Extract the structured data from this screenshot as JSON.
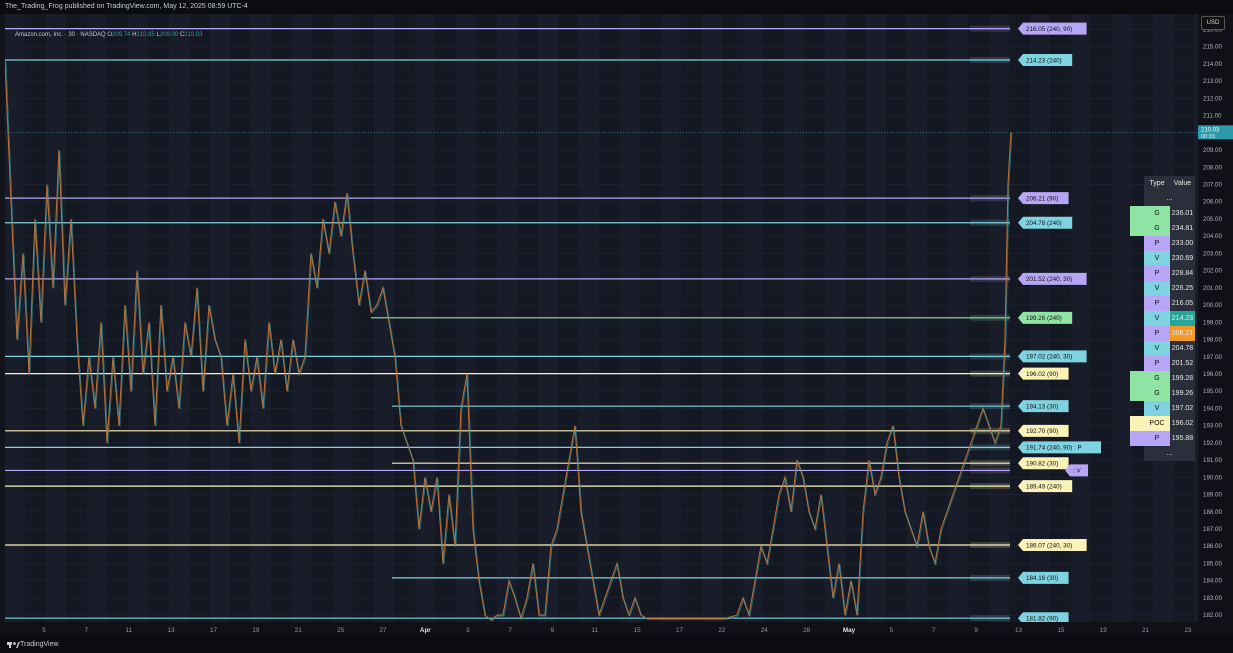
{
  "header": {
    "published": "The_Trading_Frog published on TradingView.com, May 12, 2025 08:59 UTC-4",
    "symbol": "Amazon.com, Inc. · 30 · NASDAQ",
    "ohlc": {
      "o_label": "O",
      "o": "209.74",
      "h_label": "H",
      "h": "210.85",
      "l_label": "L",
      "l": "209.00",
      "c_label": "C",
      "c": "210.03"
    }
  },
  "currency_button": "USD",
  "footer": {
    "brand": "TradingView"
  },
  "colors": {
    "green": "#8fe3a3",
    "purple": "#b7a6f5",
    "cyan": "#7fd3e0",
    "yellow": "#fbf2b8",
    "orange": "#f59a23"
  },
  "chart_data": {
    "type": "line",
    "title": "",
    "ylim": [
      181.6,
      216.9
    ],
    "price_ticks": [
      "216.00",
      "215.00",
      "214.00",
      "213.00",
      "212.00",
      "211.00",
      "210.00",
      "209.00",
      "208.00",
      "207.00",
      "206.00",
      "205.00",
      "204.00",
      "203.00",
      "202.00",
      "201.00",
      "200.00",
      "199.00",
      "198.00",
      "197.00",
      "196.00",
      "195.00",
      "194.00",
      "193.00",
      "192.00",
      "191.00",
      "190.00",
      "189.00",
      "188.00",
      "187.00",
      "186.00",
      "185.00",
      "184.00",
      "183.00",
      "182.00"
    ],
    "current_price": {
      "price": "210.03",
      "countdown": "00:33",
      "value": 210.03
    },
    "date_ticks": [
      "5",
      "7",
      "11",
      "13",
      "17",
      "19",
      "21",
      "25",
      "27",
      "Apr",
      "3",
      "7",
      "9",
      "11",
      "15",
      "17",
      "22",
      "24",
      "28",
      "May",
      "5",
      "7",
      "9",
      "13",
      "15",
      "19",
      "21",
      "23"
    ],
    "levels": [
      {
        "price": 216.05,
        "label": "216.05 (240, 90)",
        "color": "purple"
      },
      {
        "price": 214.23,
        "label": "214.23 (240)",
        "color": "cyan"
      },
      {
        "price": 206.21,
        "label": "206.21 (90)",
        "color": "purple"
      },
      {
        "price": 204.78,
        "label": "204.78 (240)",
        "color": "cyan"
      },
      {
        "price": 201.52,
        "label": "201.52 (240, 30)",
        "color": "purple"
      },
      {
        "price": 199.26,
        "label": "199.26 (240)",
        "color": "green"
      },
      {
        "price": 197.02,
        "label": "197.02 (240, 30)",
        "color": "cyan"
      },
      {
        "price": 196.02,
        "label": "196.02 (90)",
        "color": "yellow"
      },
      {
        "price": 194.13,
        "label": "194.13 (30)",
        "color": "cyan"
      },
      {
        "price": 192.7,
        "label": "192.70 (90)",
        "color": "yellow"
      },
      {
        "price": 191.74,
        "label": "191.74 (240, 90) : P",
        "color": "cyan"
      },
      {
        "price": 190.82,
        "label": "190.82 (30)",
        "color": "yellow"
      },
      {
        "price": 190.4,
        "label": ": V",
        "color": "purple"
      },
      {
        "price": 189.49,
        "label": "189.49 (240)",
        "color": "yellow"
      },
      {
        "price": 186.07,
        "label": "186.07 (240, 30)",
        "color": "yellow"
      },
      {
        "price": 184.16,
        "label": "184.16 (30)",
        "color": "cyan"
      },
      {
        "price": 181.82,
        "label": "181.82 (90)",
        "color": "cyan"
      }
    ],
    "table": {
      "header": [
        "Type",
        "Value"
      ],
      "ellipsis": "...",
      "rows": [
        {
          "type": "G",
          "value": "236.01",
          "color": "green",
          "mark": true
        },
        {
          "type": "G",
          "value": "234.81",
          "color": "green",
          "mark": true
        },
        {
          "type": "P",
          "value": "233.00",
          "color": "purple"
        },
        {
          "type": "V",
          "value": "230.69",
          "color": "cyan"
        },
        {
          "type": "P",
          "value": "228.84",
          "color": "purple"
        },
        {
          "type": "V",
          "value": "226.25",
          "color": "cyan"
        },
        {
          "type": "P",
          "value": "216.05",
          "color": "purple"
        },
        {
          "type": "V",
          "value": "214.23",
          "color": "cyan",
          "hl": "#26a69a"
        },
        {
          "type": "P",
          "value": "206.21",
          "color": "purple",
          "hl": "#f59a23"
        },
        {
          "type": "V",
          "value": "204.78",
          "color": "cyan"
        },
        {
          "type": "P",
          "value": "201.52",
          "color": "purple"
        },
        {
          "type": "G",
          "value": "199.28",
          "color": "green",
          "mark": true
        },
        {
          "type": "G",
          "value": "199.26",
          "color": "green",
          "mark": true
        },
        {
          "type": "V",
          "value": "197.02",
          "color": "cyan"
        },
        {
          "type": "POC",
          "value": "196.02",
          "color": "yellow",
          "mark": true
        },
        {
          "type": "P",
          "value": "195.88",
          "color": "purple",
          "mark": true
        }
      ]
    },
    "series_path": [
      [
        0,
        214.2
      ],
      [
        6,
        206
      ],
      [
        12,
        198
      ],
      [
        18,
        203
      ],
      [
        24,
        196
      ],
      [
        30,
        205
      ],
      [
        36,
        199
      ],
      [
        42,
        207
      ],
      [
        48,
        201
      ],
      [
        54,
        209
      ],
      [
        60,
        200
      ],
      [
        66,
        205
      ],
      [
        72,
        198
      ],
      [
        78,
        193
      ],
      [
        84,
        197
      ],
      [
        90,
        194
      ],
      [
        96,
        199
      ],
      [
        102,
        192
      ],
      [
        108,
        197
      ],
      [
        114,
        193
      ],
      [
        120,
        200
      ],
      [
        126,
        195
      ],
      [
        132,
        202
      ],
      [
        138,
        196
      ],
      [
        144,
        199
      ],
      [
        150,
        193
      ],
      [
        156,
        200
      ],
      [
        162,
        195
      ],
      [
        168,
        197
      ],
      [
        174,
        194
      ],
      [
        180,
        199
      ],
      [
        186,
        197
      ],
      [
        192,
        201
      ],
      [
        198,
        195
      ],
      [
        204,
        200
      ],
      [
        210,
        198
      ],
      [
        216,
        197
      ],
      [
        222,
        193
      ],
      [
        228,
        196
      ],
      [
        234,
        192
      ],
      [
        240,
        198
      ],
      [
        246,
        195
      ],
      [
        252,
        197
      ],
      [
        258,
        194
      ],
      [
        264,
        199
      ],
      [
        270,
        196
      ],
      [
        276,
        198
      ],
      [
        282,
        195
      ],
      [
        288,
        198
      ],
      [
        294,
        196
      ],
      [
        300,
        197
      ],
      [
        306,
        203
      ],
      [
        312,
        201
      ],
      [
        318,
        205
      ],
      [
        324,
        203
      ],
      [
        330,
        206
      ],
      [
        336,
        204
      ],
      [
        342,
        206.5
      ],
      [
        348,
        203
      ],
      [
        354,
        200
      ],
      [
        360,
        202
      ],
      [
        366,
        199.6
      ],
      [
        372,
        200
      ],
      [
        378,
        201
      ],
      [
        384,
        199
      ],
      [
        390,
        197
      ],
      [
        396,
        193
      ],
      [
        402,
        192
      ],
      [
        408,
        191
      ],
      [
        414,
        187
      ],
      [
        420,
        190
      ],
      [
        426,
        188
      ],
      [
        432,
        190
      ],
      [
        438,
        185
      ],
      [
        444,
        189
      ],
      [
        450,
        186
      ],
      [
        456,
        194
      ],
      [
        462,
        196
      ],
      [
        468,
        187
      ],
      [
        474,
        184
      ],
      [
        480,
        182
      ],
      [
        486,
        181.7
      ],
      [
        492,
        182
      ],
      [
        498,
        182
      ],
      [
        504,
        184
      ],
      [
        510,
        183
      ],
      [
        516,
        181.8
      ],
      [
        522,
        183
      ],
      [
        528,
        185
      ],
      [
        534,
        182
      ],
      [
        540,
        182
      ],
      [
        546,
        186
      ],
      [
        552,
        187
      ],
      [
        558,
        189
      ],
      [
        564,
        191
      ],
      [
        570,
        193
      ],
      [
        576,
        188
      ],
      [
        582,
        186
      ],
      [
        588,
        184
      ],
      [
        594,
        182
      ],
      [
        600,
        183
      ],
      [
        606,
        184
      ],
      [
        612,
        185
      ],
      [
        618,
        183
      ],
      [
        624,
        182
      ],
      [
        630,
        183
      ],
      [
        636,
        182
      ],
      [
        642,
        181.8
      ],
      [
        648,
        181.8
      ],
      [
        660,
        181.8
      ],
      [
        672,
        181.8
      ],
      [
        684,
        181.8
      ],
      [
        696,
        181.8
      ],
      [
        708,
        181.8
      ],
      [
        720,
        181.8
      ],
      [
        732,
        182
      ],
      [
        738,
        183
      ],
      [
        744,
        182
      ],
      [
        750,
        184
      ],
      [
        756,
        186
      ],
      [
        762,
        185
      ],
      [
        768,
        187
      ],
      [
        774,
        189
      ],
      [
        780,
        190
      ],
      [
        786,
        188
      ],
      [
        792,
        191
      ],
      [
        798,
        190
      ],
      [
        804,
        188
      ],
      [
        810,
        187
      ],
      [
        816,
        189
      ],
      [
        822,
        186
      ],
      [
        828,
        183
      ],
      [
        834,
        185
      ],
      [
        840,
        182
      ],
      [
        846,
        184
      ],
      [
        852,
        182
      ],
      [
        858,
        188
      ],
      [
        864,
        191
      ],
      [
        870,
        189
      ],
      [
        876,
        190
      ],
      [
        882,
        192
      ],
      [
        888,
        193
      ],
      [
        894,
        190
      ],
      [
        900,
        188
      ],
      [
        906,
        187
      ],
      [
        912,
        186
      ],
      [
        918,
        188
      ],
      [
        924,
        186
      ],
      [
        930,
        185
      ],
      [
        936,
        187
      ],
      [
        942,
        188
      ],
      [
        948,
        189
      ],
      [
        954,
        190
      ],
      [
        960,
        191
      ],
      [
        966,
        192
      ],
      [
        972,
        193
      ],
      [
        978,
        194
      ],
      [
        984,
        193
      ],
      [
        990,
        192
      ],
      [
        996,
        193
      ],
      [
        1000,
        198
      ],
      [
        1003,
        207
      ],
      [
        1006,
        210.03
      ]
    ]
  }
}
